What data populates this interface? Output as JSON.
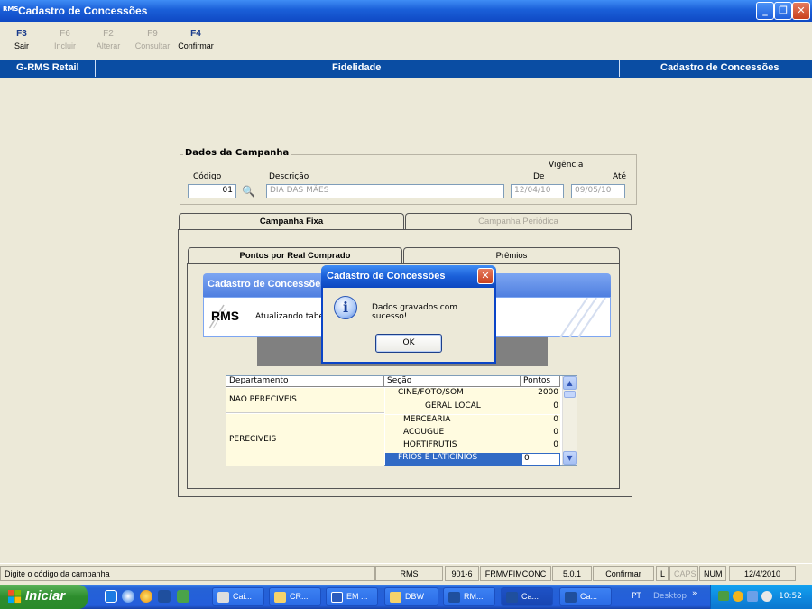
{
  "window": {
    "app_badge": "RMS",
    "title": "Cadastro de Concessões",
    "minimize": "_",
    "maximize": "❐",
    "close": "✕"
  },
  "toolbar": {
    "items": [
      {
        "key": "F3",
        "label": "Sair",
        "enabled": true
      },
      {
        "key": "F6",
        "label": "Incluir",
        "enabled": false
      },
      {
        "key": "F2",
        "label": "Alterar",
        "enabled": false
      },
      {
        "key": "F9",
        "label": "Consultar",
        "enabled": false
      },
      {
        "key": "F4",
        "label": "Confirmar",
        "enabled": true
      }
    ]
  },
  "band": {
    "left": "G-RMS Retail",
    "center": "Fidelidade",
    "right": "Cadastro de Concessões"
  },
  "campaign": {
    "group_title": "Dados da Campanha",
    "code_label": "Código",
    "code_value": "01",
    "description_label": "Descrição",
    "description_value": "DIA DAS MÃES",
    "validity_label": "Vigência",
    "from_label": "De",
    "from_value": "12/04/10",
    "to_label": "Até",
    "to_value": "09/05/10"
  },
  "tabs": {
    "outer": [
      "Campanha Fixa",
      "Campanha Periódica"
    ],
    "inner": [
      "Pontos por Real Comprado",
      "Prêmios"
    ]
  },
  "grid": {
    "headers": [
      "Departamento",
      "Seção",
      "Pontos"
    ],
    "departments": [
      "NAO PERECIVEIS",
      "PERECIVEIS"
    ],
    "rows": [
      {
        "section": "CINE/FOTO/SOM",
        "points": "2000"
      },
      {
        "section": "GERAL LOCAL",
        "points": "0"
      },
      {
        "section": "MERCEARIA",
        "points": "0"
      },
      {
        "section": "ACOUGUE",
        "points": "0"
      },
      {
        "section": "HORTIFRUTIS",
        "points": "0"
      },
      {
        "section": "FRIOS E LATICINIOS",
        "points": "0"
      }
    ]
  },
  "progress": {
    "title": "Cadastro de Concessões",
    "logo": "RMS",
    "message": "Atualizando tabel"
  },
  "dialog": {
    "title": "Cadastro de Concessões",
    "message": "Dados gravados com sucesso!",
    "ok_label": "OK",
    "icon": "info-icon"
  },
  "statusbar": {
    "hint": "Digite o código da campanha",
    "system": "RMS",
    "code": "901-6",
    "form": "FRMVFIMCONC",
    "version": "5.0.1",
    "action": "Confirmar",
    "l": "L",
    "caps": "CAPS",
    "num": "NUM",
    "date": "12/4/2010"
  },
  "taskbar": {
    "start": "Iniciar",
    "tasks": [
      "Cai...",
      "CR...",
      "EM ...",
      "DBW",
      "RM...",
      "Ca...",
      "Ca..."
    ],
    "lang": "PT",
    "desktop": "Desktop",
    "clock": "10:52"
  },
  "colors": {
    "titlebar": "#1a5fd8",
    "band": "#0a4da3",
    "selected_row": "#316ac5",
    "grid_cell": "#fffbe0"
  }
}
